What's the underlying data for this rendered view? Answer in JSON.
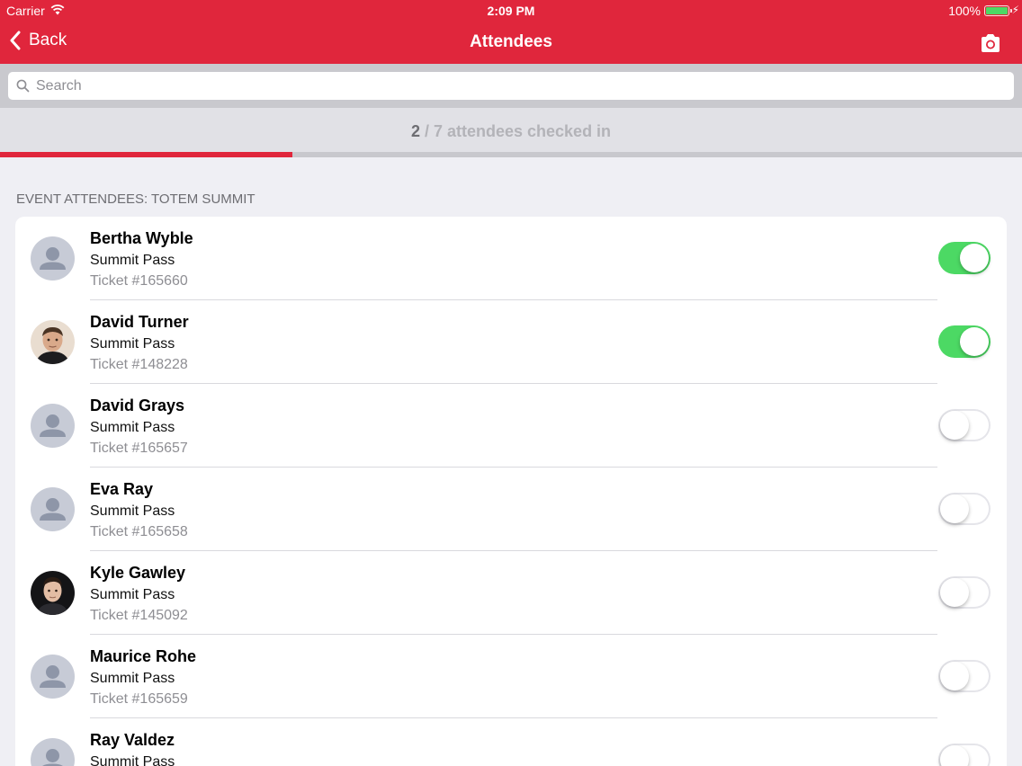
{
  "status_bar": {
    "carrier": "Carrier",
    "time": "2:09 PM",
    "battery_pct": "100%"
  },
  "nav": {
    "back_label": "Back",
    "title": "Attendees",
    "camera_icon": "camera-icon"
  },
  "search": {
    "placeholder": "Search"
  },
  "checkin": {
    "checked": "2",
    "separator": " / ",
    "rest": "7 attendees checked in",
    "fraction": 0.2857
  },
  "section_header": "EVENT ATTENDEES: TOTEM SUMMIT",
  "colors": {
    "brand": "#e0263c",
    "toggle_on": "#4cd964",
    "toggle_off": "#ffffff"
  },
  "attendees": [
    {
      "name": "Bertha Wyble",
      "pass": "Summit Pass",
      "ticket": "Ticket #165660",
      "checked_in": true,
      "avatar": "placeholder"
    },
    {
      "name": "David Turner",
      "pass": "Summit Pass",
      "ticket": "Ticket #148228",
      "checked_in": true,
      "avatar": "photo"
    },
    {
      "name": "David Grays",
      "pass": "Summit Pass",
      "ticket": "Ticket #165657",
      "checked_in": false,
      "avatar": "placeholder"
    },
    {
      "name": "Eva Ray",
      "pass": "Summit Pass",
      "ticket": "Ticket #165658",
      "checked_in": false,
      "avatar": "placeholder"
    },
    {
      "name": "Kyle Gawley",
      "pass": "Summit Pass",
      "ticket": "Ticket #145092",
      "checked_in": false,
      "avatar": "photo-dark"
    },
    {
      "name": "Maurice Rohe",
      "pass": "Summit Pass",
      "ticket": "Ticket #165659",
      "checked_in": false,
      "avatar": "placeholder"
    },
    {
      "name": "Ray Valdez",
      "pass": "Summit Pass",
      "ticket": "",
      "checked_in": false,
      "avatar": "placeholder"
    }
  ]
}
